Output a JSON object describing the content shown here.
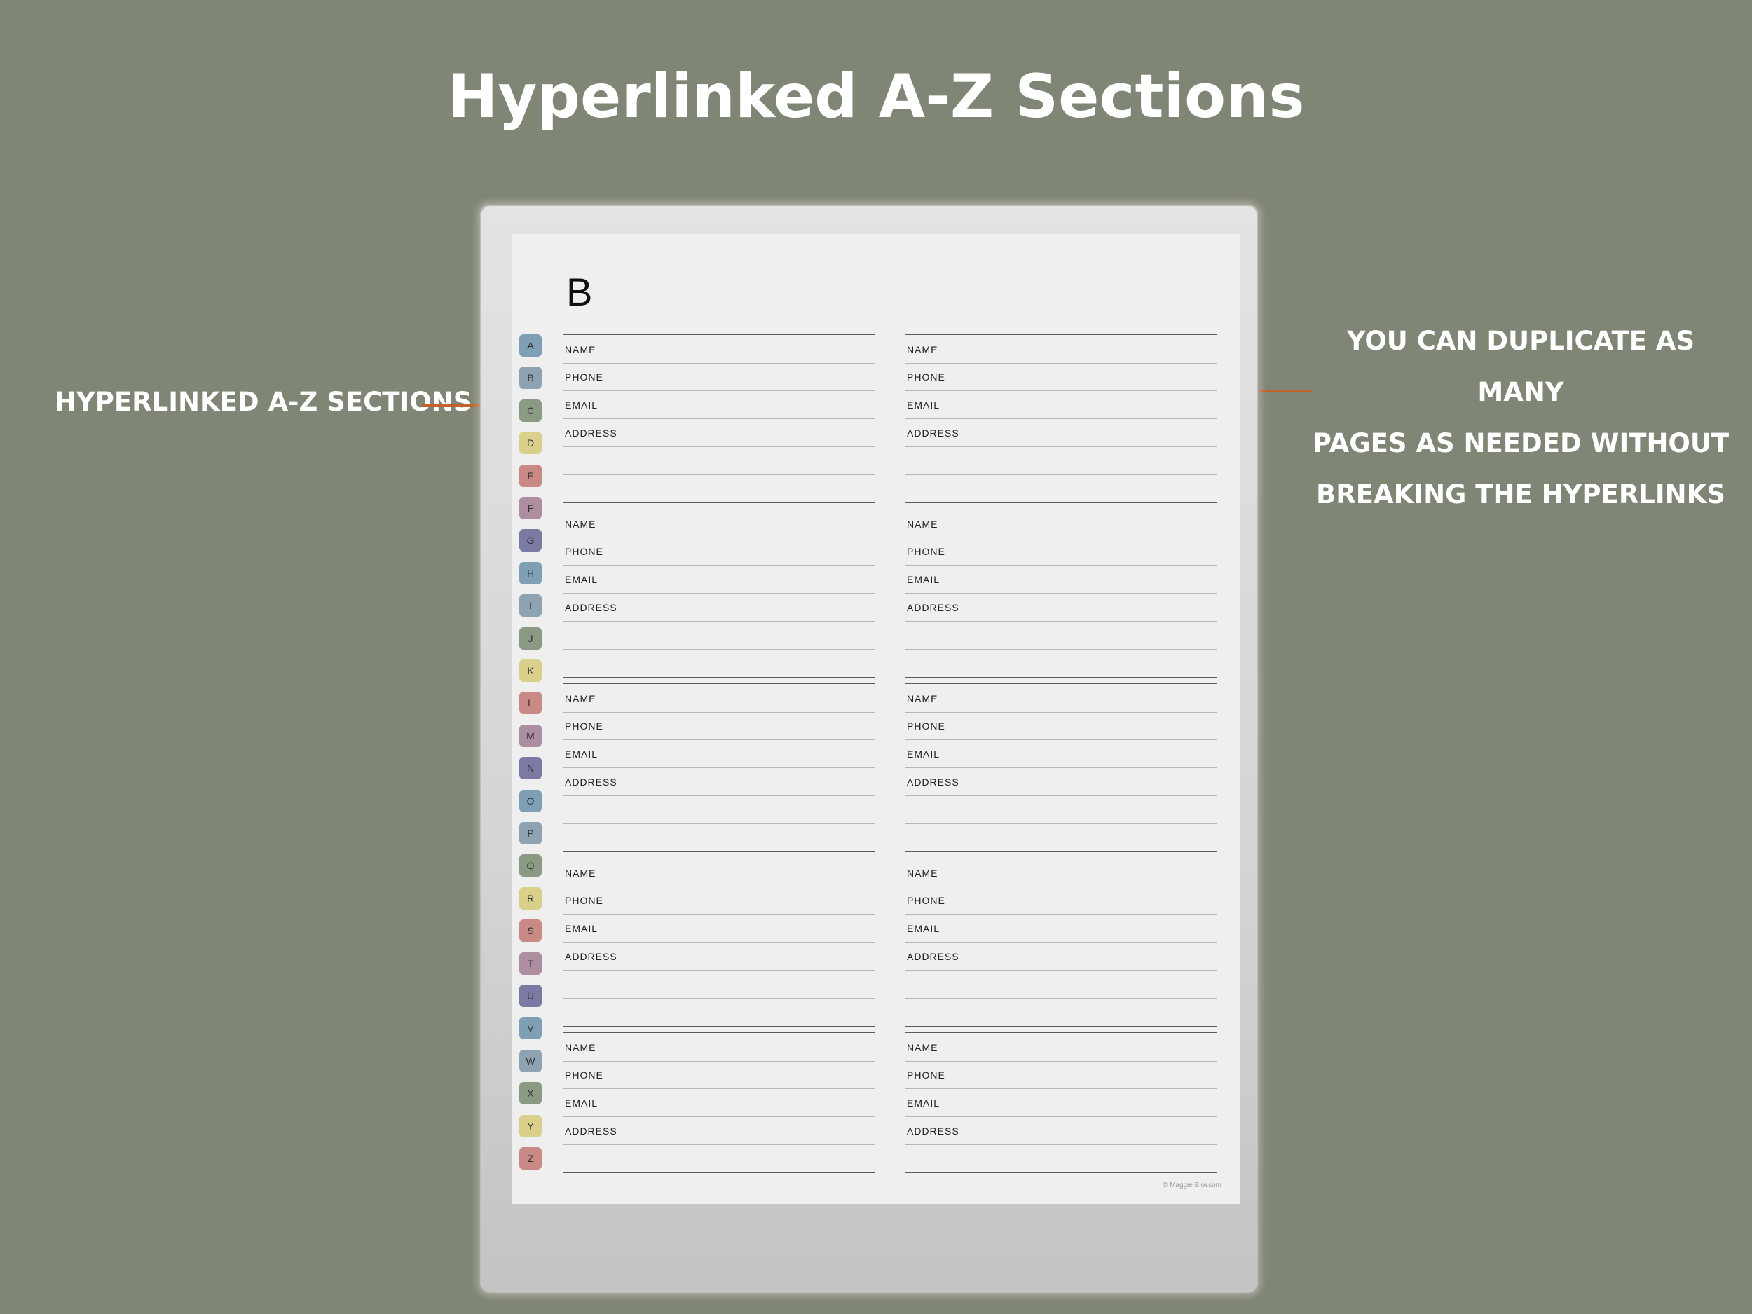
{
  "headline": "Hyperlinked A-Z Sections",
  "callouts": {
    "left": "HYPERLINKED A-Z SECTIONS",
    "right": [
      "YOU CAN DUPLICATE AS MANY",
      "PAGES AS NEEDED WITHOUT",
      "BREAKING THE HYPERLINKS"
    ]
  },
  "colors": {
    "background": "#808676",
    "arrow": "#c0622a",
    "tab_palette": [
      "#7f9fb5",
      "#8ea3b2",
      "#8a9a83",
      "#d9d08c",
      "#c98a86",
      "#ad8da0",
      "#7a7aa2"
    ]
  },
  "planner": {
    "section_letter": "B",
    "tabs": [
      "A",
      "B",
      "C",
      "D",
      "E",
      "F",
      "G",
      "H",
      "I",
      "J",
      "K",
      "L",
      "M",
      "N",
      "O",
      "P",
      "Q",
      "R",
      "S",
      "T",
      "U",
      "V",
      "W",
      "X",
      "Y",
      "Z"
    ],
    "field_labels": [
      "NAME",
      "PHONE",
      "EMAIL",
      "ADDRESS"
    ],
    "entries_per_column": 5,
    "copyright": "© Maggie Blossom"
  }
}
